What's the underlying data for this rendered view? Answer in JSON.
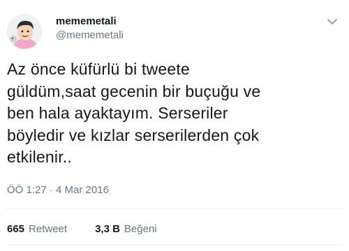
{
  "user": {
    "display_name": "mememetali",
    "handle": "@mememetali",
    "avatar_icon": "cartoon-avatar"
  },
  "menu": {
    "icon": "chevron-down-icon"
  },
  "tweet": {
    "lines": [
      "Az önce küfürlü bi tweete",
      "güldüm,saat gecenin bir buçuğu ve",
      "ben hala ayaktayım. Serseriler",
      "böyledir ve kızlar serserilerden çok",
      "etkilenir.."
    ],
    "timestamp": "ÖÖ 1:27 · 4 Mar 2016"
  },
  "stats": {
    "retweet_count": "665",
    "retweet_label": "Retweet",
    "like_count": "3,3 B",
    "like_label": "Beğeni"
  },
  "colors": {
    "text": "#14171a",
    "secondary": "#657786",
    "divider": "#e6ecf0"
  }
}
